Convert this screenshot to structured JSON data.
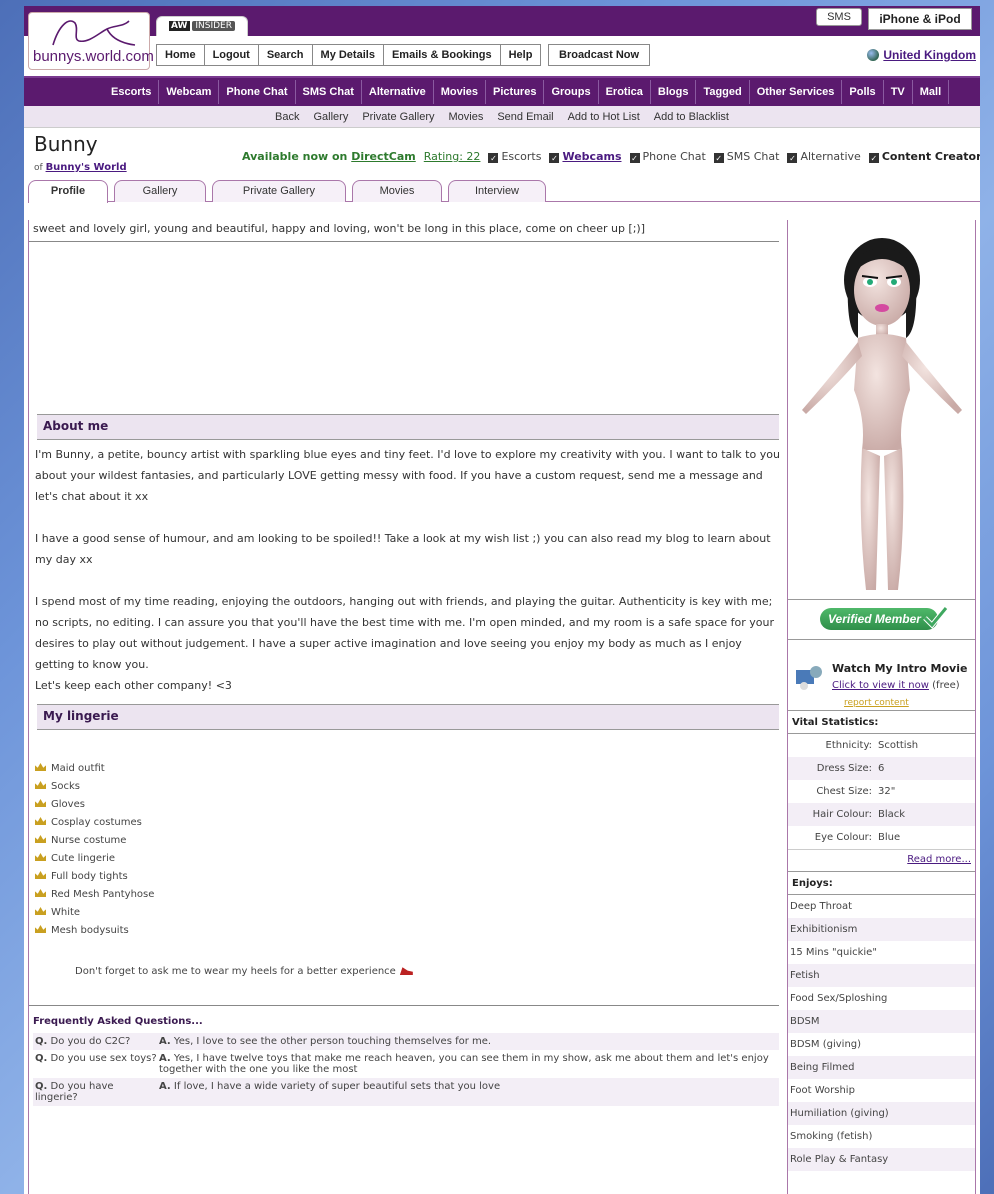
{
  "header": {
    "logo_text": "bunnys.world.com",
    "aw_insider": {
      "prefix": "AW",
      "label": "INSIDER"
    },
    "sms_label": "SMS",
    "iphone_label": "iPhone & iPod",
    "top_nav": [
      "Home",
      "Logout",
      "Search",
      "My Details",
      "Emails & Bookings",
      "Help"
    ],
    "broadcast_label": "Broadcast Now",
    "country_label": "United Kingdom"
  },
  "category_nav": [
    "Escorts",
    "Webcam",
    "Phone Chat",
    "SMS Chat",
    "Alternative",
    "Movies",
    "Pictures",
    "Groups",
    "Erotica",
    "Blogs",
    "Tagged",
    "Other Services",
    "Polls",
    "TV",
    "Mall"
  ],
  "sub_nav": [
    "Back",
    "Gallery",
    "Private Gallery",
    "Movies",
    "Send Email",
    "Add to Hot List",
    "Add to Blacklist"
  ],
  "profile": {
    "name": "Bunny",
    "of_prefix": "of",
    "of_link": "Bunny's World",
    "available_prefix": "Available now on",
    "available_link": "DirectCam",
    "rating": "Rating: 22",
    "services": [
      {
        "label": "Escorts",
        "style": "normal"
      },
      {
        "label": "Webcams",
        "style": "link"
      },
      {
        "label": "Phone Chat",
        "style": "normal"
      },
      {
        "label": "SMS Chat",
        "style": "normal"
      },
      {
        "label": "Alternative",
        "style": "normal"
      },
      {
        "label": "Content Creator",
        "style": "bold"
      }
    ]
  },
  "tabs": [
    "Profile",
    "Gallery",
    "Private Gallery",
    "Movies",
    "Interview"
  ],
  "tagline": "sweet and lovely girl, young and beautiful, happy and loving, won't be long in this place, come on cheer up [;)]",
  "about": {
    "heading": "About me",
    "p1": "I'm Bunny, a petite, bouncy artist with sparkling blue eyes and tiny feet. I'd love to explore my creativity with you. I want to talk to you about your wildest fantasies, and particularly LOVE getting messy with food. If you have a custom request, send me a message and let's chat about it xx",
    "p2": "I have a good sense of humour, and am looking to be spoiled!! Take a look at my wish list ;) you can also read my blog to learn about my day xx",
    "p3": "I spend most of my time reading, enjoying the outdoors, hanging out with friends, and playing the guitar. Authenticity is key with me; no scripts, no editing. I can assure you that you'll have the best time with me. I'm open minded, and my room is a safe space for your desires to play out without judgement. I have a super active imagination and love seeing you enjoy my body as much as I enjoy getting to know you.",
    "p4": "Let's keep each other company! <3"
  },
  "lingerie": {
    "heading": "My lingerie",
    "items": [
      "Maid outfit",
      "Socks",
      "Gloves",
      "Cosplay costumes",
      "Nurse costume",
      "Cute lingerie",
      "Full body tights",
      "Red Mesh Pantyhose",
      "White",
      "Mesh bodysuits"
    ],
    "note": "Don't forget to ask me to wear my heels for a better experience"
  },
  "faq": {
    "heading": "Frequently Asked Questions...",
    "rows": [
      {
        "q": "Do you do C2C?",
        "a": "Yes, I love to see the other person touching themselves for me."
      },
      {
        "q": "Do you use sex toys?",
        "a": "Yes, I have twelve toys that make me reach heaven, you can see them in my show, ask me about them and let's enjoy together with the one you like the most"
      },
      {
        "q": "Do you have lingerie?",
        "a": "If love, I have a wide variety of super beautiful sets that you love"
      }
    ],
    "q_prefix": "Q.",
    "a_prefix": "A."
  },
  "sidebar": {
    "verified_label": "Verified Member",
    "intro_title": "Watch My Intro Movie",
    "intro_link": "Click to view it now",
    "intro_suffix": "(free)",
    "report_label": "report content",
    "vital_heading": "Vital Statistics:",
    "vitals": [
      {
        "k": "Ethnicity:",
        "v": "Scottish"
      },
      {
        "k": "Dress Size:",
        "v": "6"
      },
      {
        "k": "Chest Size:",
        "v": "32\""
      },
      {
        "k": "Hair Colour:",
        "v": "Black"
      },
      {
        "k": "Eye Colour:",
        "v": "Blue"
      }
    ],
    "read_more": "Read more...",
    "enjoys_heading": "Enjoys:",
    "enjoys": [
      "Deep Throat",
      "Exhibitionism",
      "15 Mins \"quickie\"",
      "Fetish",
      "Food Sex/Sploshing",
      "BDSM",
      "BDSM (giving)",
      "Being Filmed",
      "Foot Worship",
      "Humiliation (giving)",
      "Smoking (fetish)",
      "Role Play & Fantasy"
    ]
  },
  "colors": {
    "brand_purple": "#5b1a6e",
    "verified_green": "#2f8f4a",
    "link_purple": "#4a1a80"
  }
}
